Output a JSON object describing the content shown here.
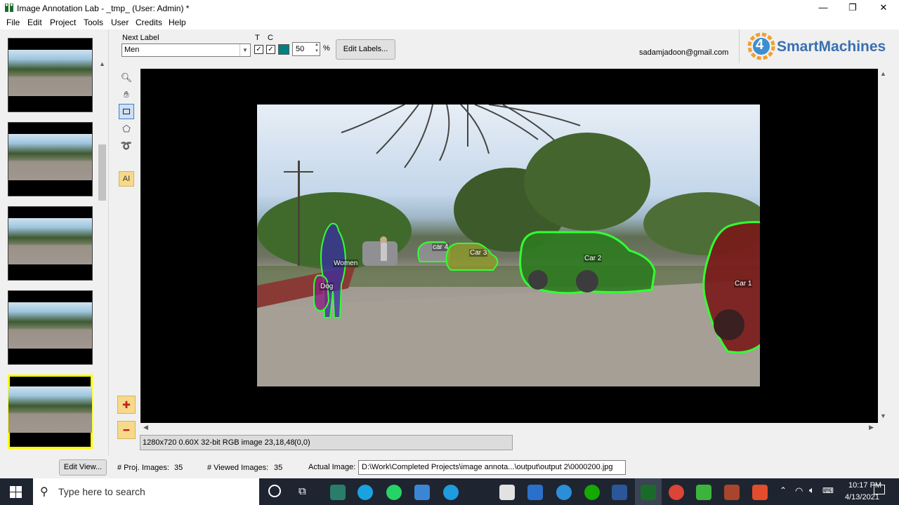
{
  "window": {
    "title": "Image Annotation Lab - _tmp_  (User: Admin) *",
    "minimize": "—",
    "maximize": "❐",
    "close": "✕"
  },
  "menu": [
    "File",
    "Edit",
    "Project",
    "Tools",
    "User",
    "Credits",
    "Help"
  ],
  "toolbar": {
    "next_label_caption": "Next Label",
    "next_label_value": "Men",
    "t_caption": "T",
    "c_caption": "C",
    "opacity_value": "50",
    "percent": "%",
    "edit_labels": "Edit Labels...",
    "email": "sadamjadoon@gmail.com",
    "logo_number": "4",
    "logo_text": "SmartMachines"
  },
  "tools": {
    "ai_label": "AI"
  },
  "annotations": {
    "women": "Women",
    "dog": "Dog",
    "car4": "car 4",
    "car3": "Car 3",
    "car2": "Car 2",
    "car1": "Car 1"
  },
  "status": {
    "info": "1280x720 0.60X 32-bit RGB image 23,18,48",
    "coords": "(0,0)"
  },
  "bottom": {
    "edit_view": "Edit View...",
    "proj_images_label": "# Proj. Images:",
    "proj_images_value": "35",
    "viewed_images_label": "# Viewed Images:",
    "viewed_images_value": "35",
    "actual_image_label": "Actual Image:",
    "actual_image_path": "D:\\Work\\Completed Projects\\image annota...\\output\\output 2\\0000200.jpg"
  },
  "taskbar": {
    "search_placeholder": "Type here to search",
    "time": "10:17 PM",
    "date": "4/13/2021"
  },
  "colors": {
    "green_outline": "#33ff33",
    "selection_yellow": "#ffff00",
    "teal_swatch": "#008080"
  }
}
